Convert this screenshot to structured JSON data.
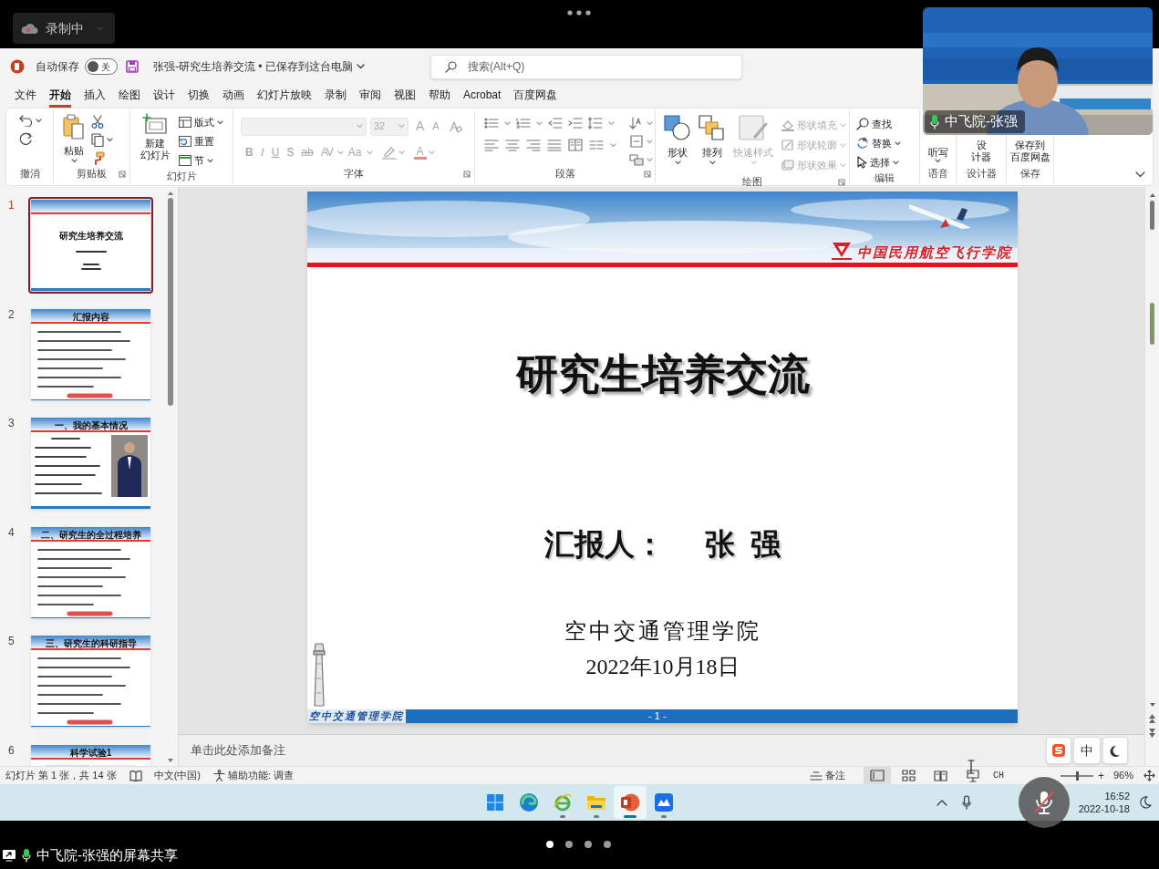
{
  "top_bar": {
    "recording": "录制中"
  },
  "video": {
    "kind": "picture",
    "name": "中飞院-张强"
  },
  "app": {
    "autosave": {
      "label": "自动保存",
      "toggle_text": "关",
      "on": false
    },
    "document_title": "张强-研究生培养交流 • 已保存到这台电脑",
    "search": {
      "placeholder": "搜索(Alt+Q)"
    },
    "menu": [
      {
        "label": "文件",
        "selected": false
      },
      {
        "label": "开始",
        "selected": true
      },
      {
        "label": "插入",
        "selected": false
      },
      {
        "label": "绘图",
        "selected": false
      },
      {
        "label": "设计",
        "selected": false
      },
      {
        "label": "切换",
        "selected": false
      },
      {
        "label": "动画",
        "selected": false
      },
      {
        "label": "幻灯片放映",
        "selected": false
      },
      {
        "label": "录制",
        "selected": false
      },
      {
        "label": "审阅",
        "selected": false
      },
      {
        "label": "视图",
        "selected": false
      },
      {
        "label": "帮助",
        "selected": false
      },
      {
        "label": "Acrobat",
        "selected": false
      },
      {
        "label": "百度网盘",
        "selected": false
      }
    ],
    "ribbon": {
      "groups": [
        {
          "kind": "undo",
          "label": "撤消"
        },
        {
          "kind": "clipboard",
          "label": "剪贴板",
          "paste": "粘贴"
        },
        {
          "kind": "slides",
          "label": "幻灯片",
          "new_slide": [
            "新建",
            "幻灯片"
          ],
          "items": [
            "版式",
            "重置",
            "节"
          ]
        },
        {
          "kind": "font",
          "label": "字体",
          "disabled": true,
          "font_size": "32",
          "size_glyphs": [
            "A",
            "A"
          ],
          "styles": [
            "B",
            "I",
            "U",
            "S",
            "ab",
            "AV",
            "Aa"
          ],
          "color_glyph": "A"
        },
        {
          "kind": "paragraph",
          "label": "段落"
        },
        {
          "kind": "drawing",
          "label": "绘图",
          "large": [
            {
              "label": "形状",
              "disabled": false
            },
            {
              "label": "排列",
              "disabled": false
            },
            {
              "label": "快速样式",
              "disabled": true
            }
          ],
          "small": [
            {
              "label": "形状填充",
              "disabled": true
            },
            {
              "label": "形状轮廓",
              "disabled": true
            },
            {
              "label": "形状效果",
              "disabled": true
            }
          ]
        },
        {
          "kind": "editing",
          "label": "编辑",
          "items": [
            "查找",
            "替换",
            "选择"
          ]
        },
        {
          "kind": "voice",
          "label": "语音",
          "button": [
            "听写"
          ]
        },
        {
          "kind": "designer",
          "label": "设计器",
          "button": [
            "设",
            "计器"
          ]
        },
        {
          "kind": "save",
          "label": "保存",
          "button": [
            "保存到",
            "百度网盘"
          ]
        }
      ]
    },
    "thumbnails": [
      {
        "number": "1",
        "selected": true,
        "kind": "title",
        "title": "研究生培养交流"
      },
      {
        "number": "2",
        "selected": false,
        "kind": "list",
        "title": "汇报内容"
      },
      {
        "number": "3",
        "selected": false,
        "title": "一、我的基本情况"
      },
      {
        "number": "4",
        "selected": false,
        "kind": "list",
        "title": "二、研究生的全过程培养"
      },
      {
        "number": "5",
        "selected": false,
        "kind": "list",
        "title": "三、研究生的科研指导"
      },
      {
        "number": "6",
        "selected": false,
        "kind": "images",
        "title": "科学试验1"
      }
    ],
    "slide": {
      "logo_text": "中国民用航空飞行学院",
      "title": "研究生培养交流",
      "reporter_label": "汇报人：",
      "reporter": "张  强",
      "institute": "空中交通管理学院",
      "date": "2022年10月18日",
      "footer_text": "空中交通管理学院",
      "page": "- 1 -"
    },
    "notes": {
      "placeholder": "单击此处添加备注"
    },
    "status_bar": {
      "slide_info": "幻灯片 第 1 张，共 14 张",
      "language": "中文(中国)",
      "accessibility": "辅助功能: 调查",
      "notes": "备注",
      "views": [
        {
          "kind": "normal",
          "selected": true
        },
        {
          "kind": "sorter",
          "selected": false
        },
        {
          "kind": "reading",
          "selected": false
        },
        {
          "kind": "slideshow",
          "selected": false
        }
      ],
      "input_lang": "CH",
      "zoom_slider": {
        "level": 0.48
      },
      "zoom_plus": "+",
      "zoom": "96%"
    }
  },
  "ime_toolbar": {
    "mode": "中"
  },
  "taskbar": {
    "apps": [
      {
        "kind": "start",
        "running": false,
        "selected": false
      },
      {
        "kind": "edge",
        "running": false,
        "selected": false
      },
      {
        "kind": "ie",
        "running": true,
        "selected": false
      },
      {
        "kind": "folder",
        "running": true,
        "selected": false
      },
      {
        "kind": "powerpoint",
        "running": true,
        "selected": true
      },
      {
        "kind": "meeting",
        "running": true,
        "selected": false
      }
    ],
    "time": "16:52",
    "date": "2022-10-18"
  },
  "share_bar": {
    "label": "中飞院-张强的屏幕共享",
    "pages": [
      {
        "selected": true
      },
      {
        "selected": false
      },
      {
        "selected": false
      },
      {
        "selected": false
      }
    ]
  }
}
